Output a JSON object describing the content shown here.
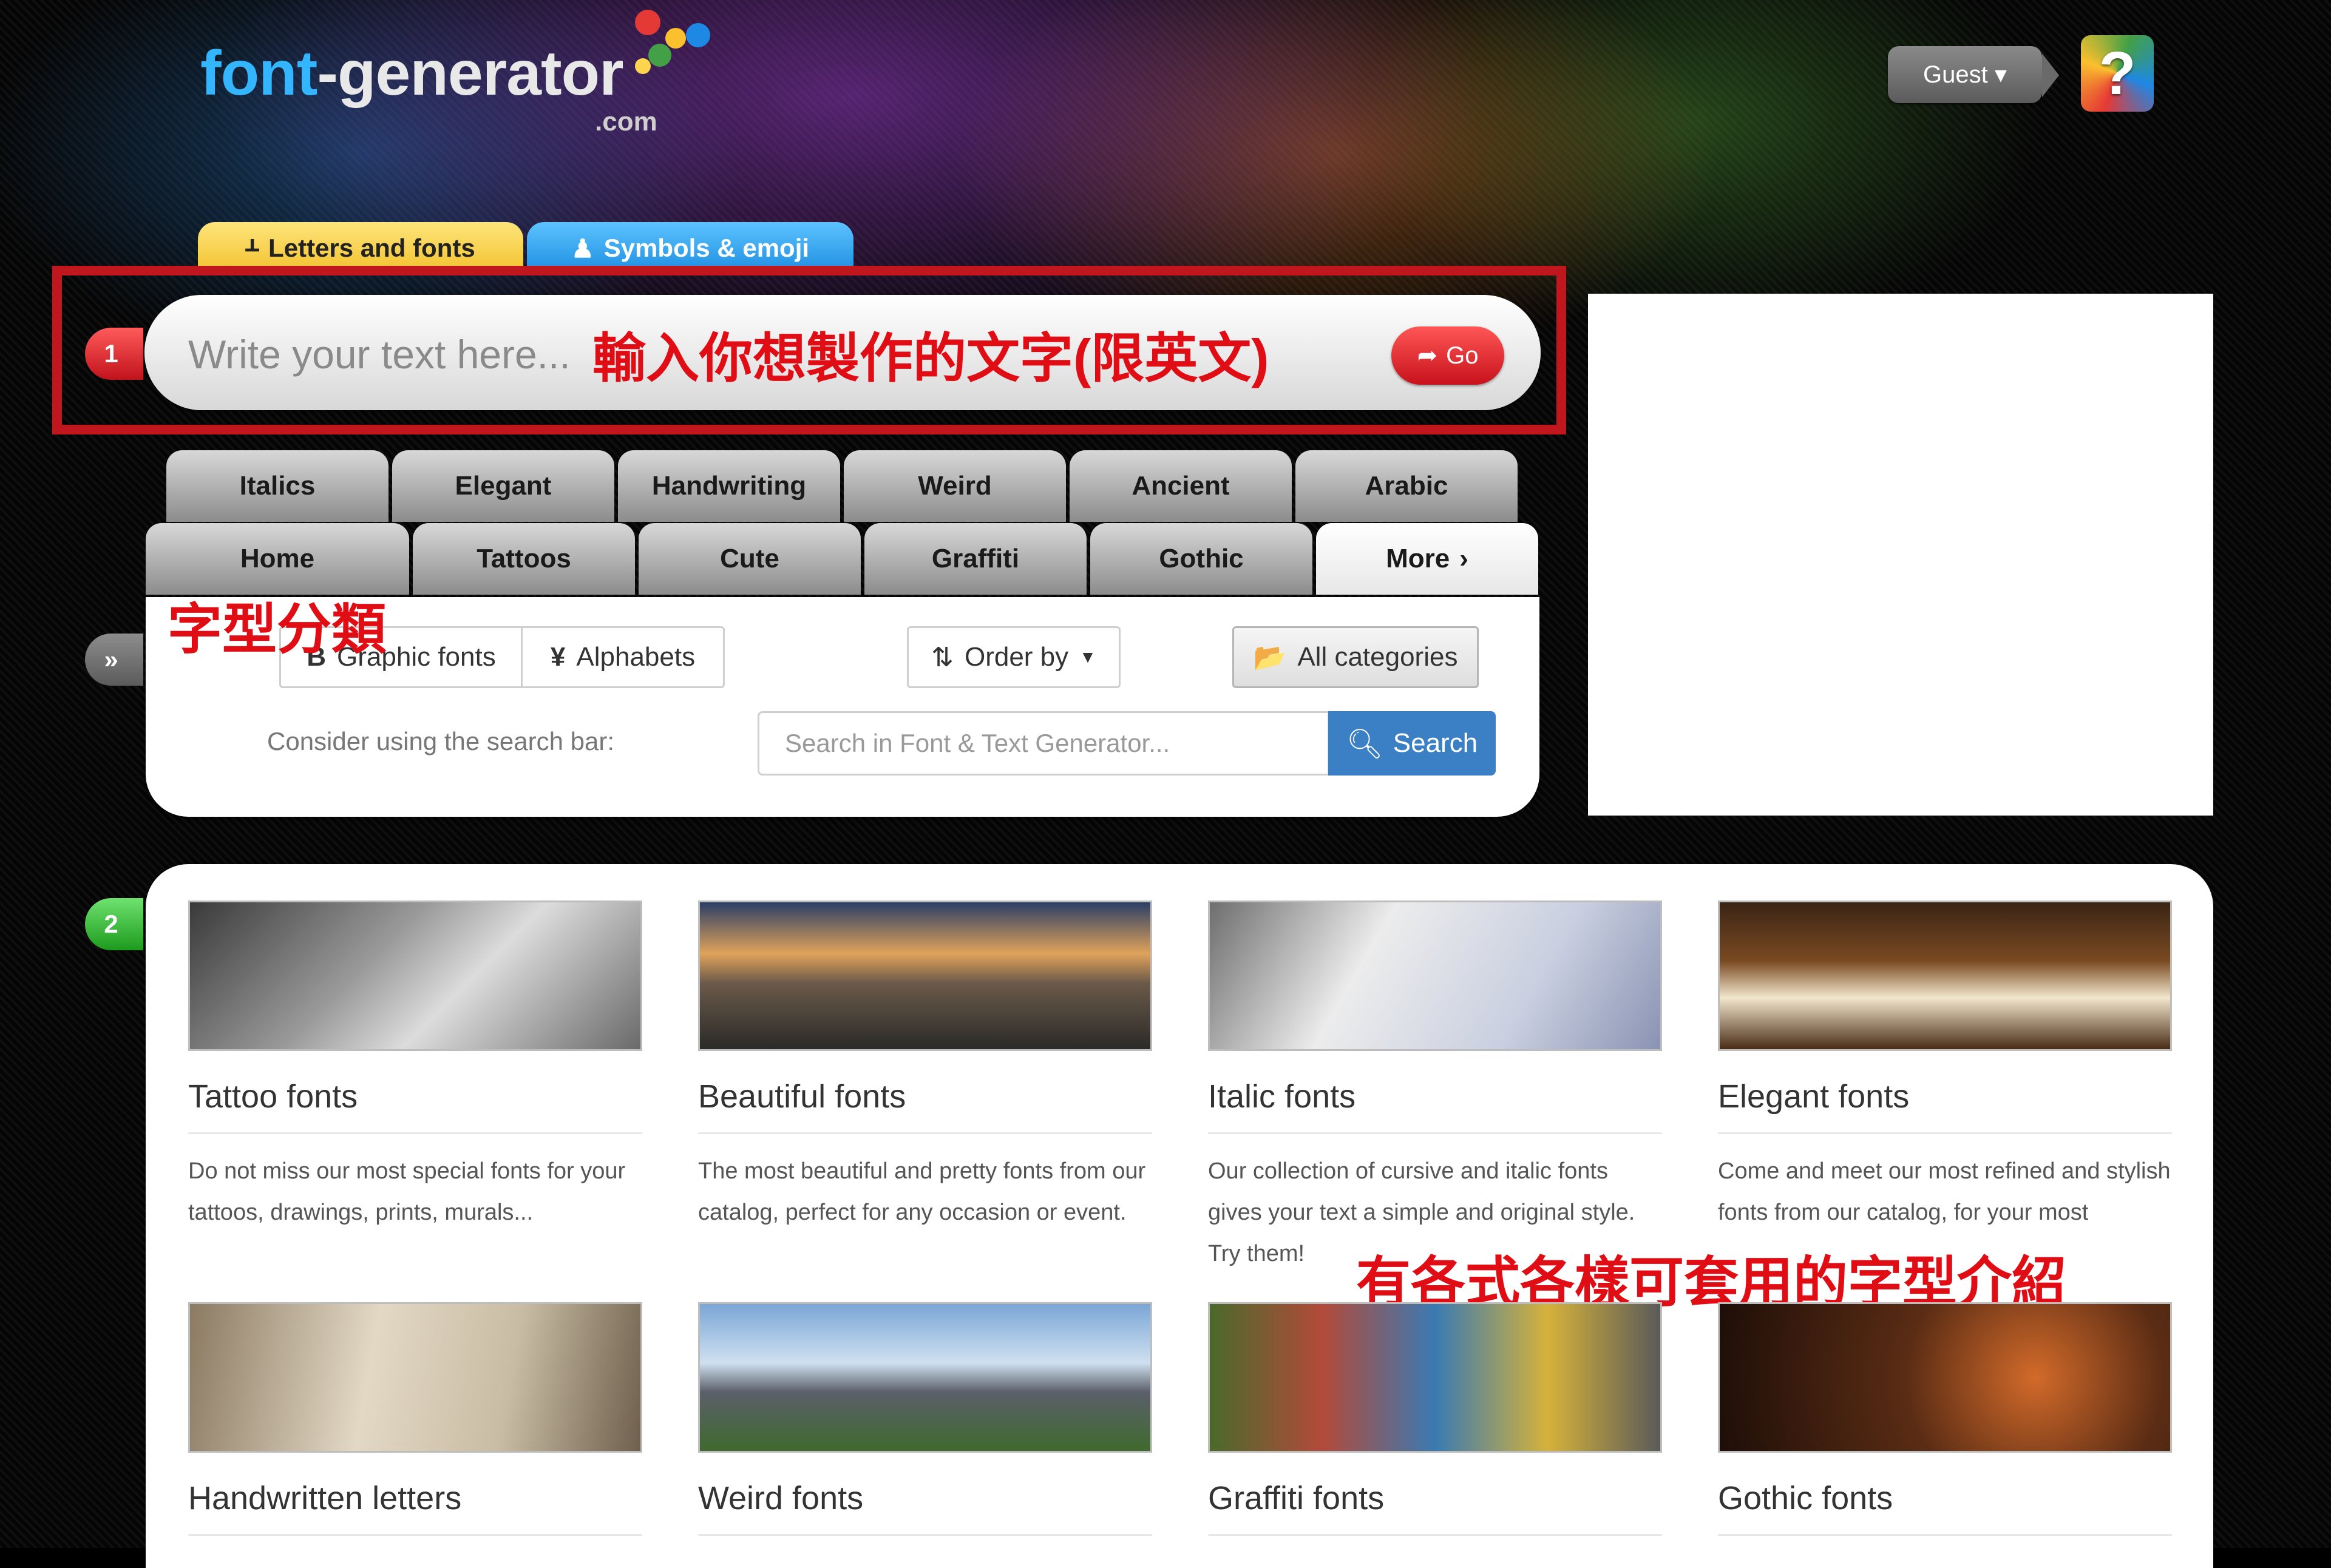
{
  "header": {
    "logo_main": "font",
    "logo_dash": "-generator",
    "logo_com": ".com",
    "guest_label": "Guest ▾",
    "help_label": "?"
  },
  "tabs": {
    "letters": "Letters and fonts",
    "symbols": "Symbols & emoji"
  },
  "input": {
    "step": "1",
    "placeholder": "Write your text here...",
    "go_label": "Go",
    "annotation": "輸入你想製作的文字(限英文)"
  },
  "categories": {
    "row1": [
      "Italics",
      "Elegant",
      "Handwriting",
      "Weird",
      "Ancient",
      "Arabic"
    ],
    "row2": [
      "Home",
      "Tattoos",
      "Cute",
      "Graffiti",
      "Gothic",
      "More"
    ]
  },
  "panel": {
    "toggle": "»",
    "annotation": "字型分類",
    "graphic_fonts": "Graphic fonts",
    "alphabets": "Alphabets",
    "order_by": "Order by",
    "all_categories": "All categories",
    "consider": "Consider using the search bar:",
    "search_placeholder": "Search in Font & Text Generator...",
    "search_button": "Search"
  },
  "gallery": {
    "step": "2",
    "annotation": "有各式各樣可套用的字型介紹",
    "cards": [
      {
        "title": "Tattoo fonts",
        "desc": "Do not miss our most special fonts for your tattoos, drawings, prints, murals..."
      },
      {
        "title": "Beautiful fonts",
        "desc": "The most beautiful and pretty fonts from our catalog, perfect for any occasion or event."
      },
      {
        "title": "Italic fonts",
        "desc": "Our collection of cursive and italic fonts gives your text a simple and original style. Try them!"
      },
      {
        "title": "Elegant fonts",
        "desc": "Come and meet our most refined and stylish fonts from our catalog, for your most classical texts."
      },
      {
        "title": "Handwritten letters",
        "desc": ""
      },
      {
        "title": "Weird fonts",
        "desc": ""
      },
      {
        "title": "Graffiti fonts",
        "desc": ""
      },
      {
        "title": "Gothic fonts",
        "desc": ""
      }
    ]
  },
  "colors": {
    "accent_red": "#c0171e",
    "go_red": "#e02a2a",
    "search_blue": "#3b7fc4",
    "letters_tab": "#f5c93a",
    "symbols_tab": "#2a9ae8"
  }
}
